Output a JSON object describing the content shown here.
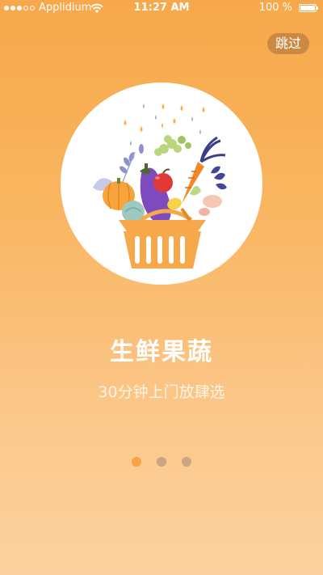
{
  "status_bar": {
    "carrier": "Applidium",
    "time": "11:27 AM",
    "battery": "100 %"
  },
  "skip_label": "跳过",
  "onboarding": {
    "title": "生鲜果蔬",
    "subtitle": "30分钟上门放肆选",
    "illustration": "basket-of-vegetables-icon"
  },
  "pager": {
    "count": 3,
    "active_index": 0
  },
  "colors": {
    "background_top": "#f7a84a",
    "background_bottom": "#fcd3a0",
    "active_dot": "#f8a43f",
    "inactive_dot": "#c9a580",
    "basket": "#f7a84a"
  }
}
